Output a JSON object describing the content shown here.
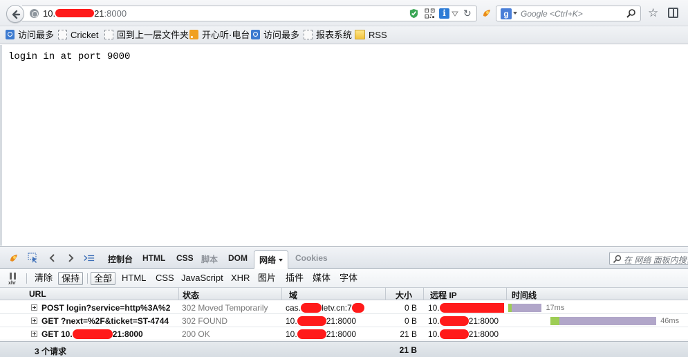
{
  "browser": {
    "url_prefix": "10.",
    "url_host_tail": "21",
    "url_port": ":8000",
    "search_placeholder": "Google <Ctrl+K>",
    "search_engine_badge": "g",
    "info_badge": "i"
  },
  "bookmarks": [
    {
      "label": "访问最多",
      "icon": "visited-icon"
    },
    {
      "label": "Cricket",
      "icon": "blank-page-icon"
    },
    {
      "label": "回到上一层文件夹",
      "icon": "blank-page-icon"
    },
    {
      "label": "开心听·电台",
      "icon": "rss-icon"
    },
    {
      "label": "访问最多",
      "icon": "visited-icon"
    },
    {
      "label": "报表系统",
      "icon": "blank-page-icon"
    },
    {
      "label": "RSS",
      "icon": "folder-icon"
    }
  ],
  "page": {
    "body_text": "login in at port 9000"
  },
  "firebug": {
    "tabs": [
      {
        "label": "控制台",
        "state": "normal"
      },
      {
        "label": "HTML",
        "state": "normal"
      },
      {
        "label": "CSS",
        "state": "normal"
      },
      {
        "label": "脚本",
        "state": "dim"
      },
      {
        "label": "DOM",
        "state": "normal"
      },
      {
        "label": "网络",
        "state": "active"
      },
      {
        "label": "Cookies",
        "state": "dim"
      }
    ],
    "search_placeholder": "在 网络 面板内搜索",
    "toolbar": {
      "xhr_icon_label": "xhr",
      "clear": "清除",
      "persist": "保持",
      "filters": [
        "全部",
        "HTML",
        "CSS",
        "JavaScript",
        "XHR",
        "图片",
        "插件",
        "媒体",
        "字体"
      ],
      "active_filter": "全部"
    },
    "columns": {
      "url": "URL",
      "status": "状态",
      "domain": "域",
      "size": "大小",
      "remote_ip": "远程 IP",
      "timeline": "时间线"
    },
    "requests": [
      {
        "url": "POST login?service=http%3A%2",
        "status": "302 Moved Temporarily",
        "domain_prefix": "cas.",
        "domain_suffix": "letv.cn:7",
        "size": "0 B",
        "ip_prefix": "10.",
        "ip_suffix": "",
        "duration": "17ms",
        "timeline_start_frac": 0.0,
        "timeline_wait_frac": 0.02,
        "timeline_recv_frac": 0.17
      },
      {
        "url": "GET ?next=%2F&ticket=ST-4744",
        "status": "302 FOUND",
        "domain_prefix": "10.",
        "domain_suffix": "21:8000",
        "size": "0 B",
        "ip_prefix": "10.",
        "ip_suffix": "21:8000",
        "duration": "46ms",
        "timeline_start_frac": 0.24,
        "timeline_wait_frac": 0.05,
        "timeline_recv_frac": 0.55
      },
      {
        "url_prefix": "GET 10.",
        "url_suffix": "21:8000",
        "status": "200 OK",
        "domain_prefix": "10.",
        "domain_suffix": "21:8000",
        "size": "21 B",
        "ip_prefix": "10.",
        "ip_suffix": "21:8000",
        "duration": "",
        "timeline_start_frac": 0,
        "timeline_wait_frac": 0,
        "timeline_recv_frac": 0
      }
    ],
    "summary": {
      "count": "3 个请求",
      "total_size": "21 B"
    }
  },
  "colors": {
    "redaction": "#ff1a1a",
    "timeline_wait": "#9dcd55",
    "timeline_receive": "#b1a6c9"
  }
}
